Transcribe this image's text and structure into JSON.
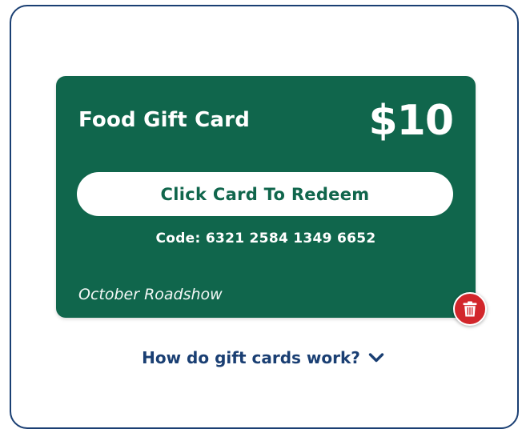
{
  "gift_card": {
    "title": "Food Gift Card",
    "amount": "$10",
    "redeem_label": "Click Card To Redeem",
    "code": "Code: 6321 2584 1349 6652",
    "event": "October Roadshow"
  },
  "help": {
    "link_label": "How do gift cards work?"
  },
  "icons": {
    "delete": "trash-icon",
    "expand": "chevron-down-icon"
  },
  "colors": {
    "card_green": "#10664c",
    "navy": "#1a3f73",
    "delete_red": "#d2262b"
  }
}
